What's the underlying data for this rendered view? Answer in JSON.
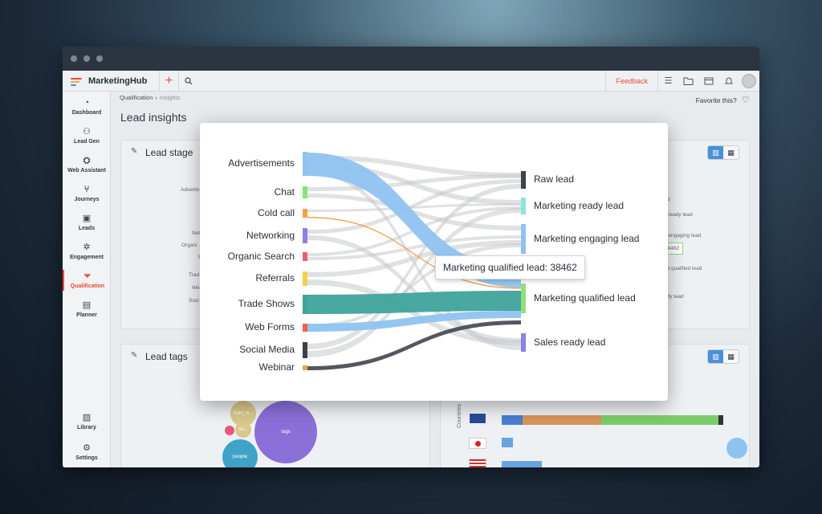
{
  "app": {
    "name": "MarketingHub"
  },
  "topbar": {
    "feedback_label": "Feedback"
  },
  "sidebar": {
    "items": [
      {
        "label": "Dashboard",
        "icon": "dashboard-icon"
      },
      {
        "label": "Lead Gen",
        "icon": "lead-gen-icon"
      },
      {
        "label": "Web Assistant",
        "icon": "web-assistant-icon"
      },
      {
        "label": "Journeys",
        "icon": "journeys-icon"
      },
      {
        "label": "Leads",
        "icon": "leads-icon"
      },
      {
        "label": "Engagement",
        "icon": "engagement-icon"
      },
      {
        "label": "Qualification",
        "icon": "filter-icon",
        "active": true
      },
      {
        "label": "Planner",
        "icon": "planner-icon"
      },
      {
        "label": "Library",
        "icon": "library-icon"
      },
      {
        "label": "Settings",
        "icon": "settings-icon"
      }
    ]
  },
  "breadcrumb": {
    "parent": "Qualification",
    "current": "insights"
  },
  "favorite_label": "Favorite this?",
  "page_title": "Lead insights",
  "cards": {
    "lead_stage_title": "Lead stage",
    "lead_tags_title": "Lead tags"
  },
  "background_fragments": {
    "left_labels": [
      "Advertis",
      "Net",
      "Organi",
      "R",
      "Trad",
      "Web",
      "Soci"
    ],
    "right_labels": [
      "d",
      "g ready lead",
      "g engaging lead",
      "38462",
      "ed qualified lead",
      "ady lead"
    ],
    "bubbles": [
      "from_w...",
      "so...",
      "tags",
      "people"
    ],
    "countries_label": "Countries"
  },
  "sankey": {
    "sources": [
      {
        "name": "Advertisements",
        "color": "#8ec3f0"
      },
      {
        "name": "Chat",
        "color": "#8fe07a"
      },
      {
        "name": "Cold call",
        "color": "#f5a14a"
      },
      {
        "name": "Networking",
        "color": "#8b80e8"
      },
      {
        "name": "Organic Search",
        "color": "#ee5a7a"
      },
      {
        "name": "Referrals",
        "color": "#f0d24a"
      },
      {
        "name": "Trade Shows",
        "color": "#3fa39a"
      },
      {
        "name": "Web Forms",
        "color": "#f0604a"
      },
      {
        "name": "Social Media",
        "color": "#3d4148"
      },
      {
        "name": "Webinar",
        "color": "#f5a14a"
      }
    ],
    "targets": [
      {
        "name": "Raw lead",
        "color": "#3d4148"
      },
      {
        "name": "Marketing ready lead",
        "color": "#8ee3e0"
      },
      {
        "name": "Marketing engaging lead",
        "color": "#8ec3f0"
      },
      {
        "name": "Marketing qualified lead",
        "color": "#8fe07a"
      },
      {
        "name": "Sales ready lead",
        "color": "#8b80e8"
      }
    ],
    "tooltip": "Marketing qualified lead: 38462"
  }
}
